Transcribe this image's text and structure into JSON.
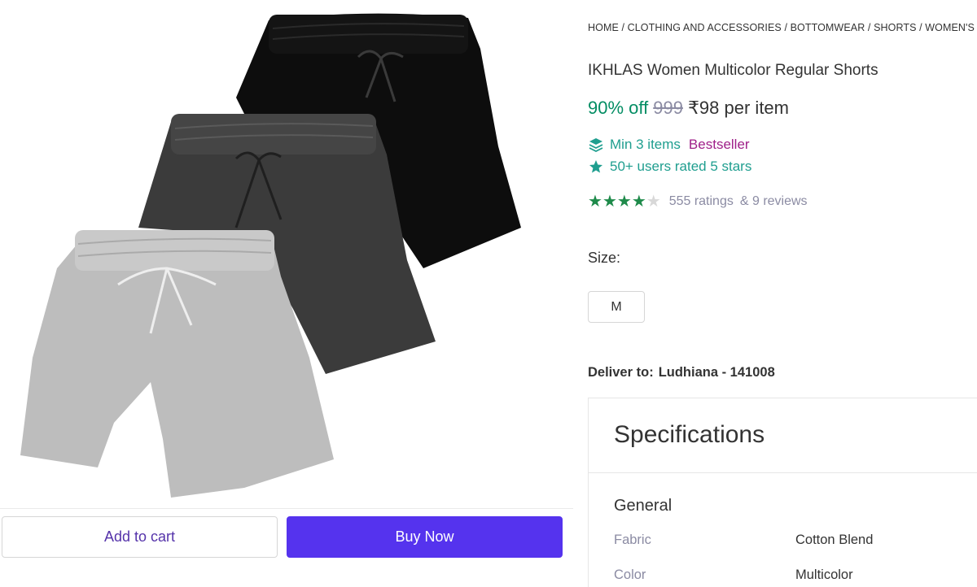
{
  "breadcrumb": [
    "HOME",
    "CLOTHING AND ACCESSORIES",
    "BOTTOMWEAR",
    "SHORTS",
    "WOMEN'S S"
  ],
  "breadcrumb_sep": " / ",
  "product": {
    "title": "IKHLAS Women Multicolor Regular Shorts",
    "discount": "90% off",
    "mrp": "999",
    "price": "₹98 per item"
  },
  "promos": {
    "min_items": "Min 3 items",
    "bestseller": "Bestseller",
    "rated": "50+ users rated 5 stars"
  },
  "rating": {
    "stars": 4,
    "max_stars": 5,
    "ratings_count": "555 ratings",
    "reviews_count": "& 9 reviews"
  },
  "size": {
    "label": "Size:",
    "options": [
      "M"
    ]
  },
  "delivery": {
    "label": "Deliver to:",
    "location": "Ludhiana - 141008"
  },
  "actions": {
    "add_to_cart": "Add to cart",
    "buy_now": "Buy Now"
  },
  "specifications": {
    "title": "Specifications",
    "group": "General",
    "rows": [
      {
        "key": "Fabric",
        "value": "Cotton Blend"
      },
      {
        "key": "Color",
        "value": "Multicolor"
      }
    ]
  },
  "colors": {
    "discount_green": "#038d63",
    "accent_purple": "#5533ee",
    "teal": "#1f9e8f",
    "bestseller_purple": "#9f2089",
    "star_green": "#1e8a4a"
  },
  "icons": [
    "layers-icon",
    "star-badge-icon",
    "star-icon"
  ]
}
